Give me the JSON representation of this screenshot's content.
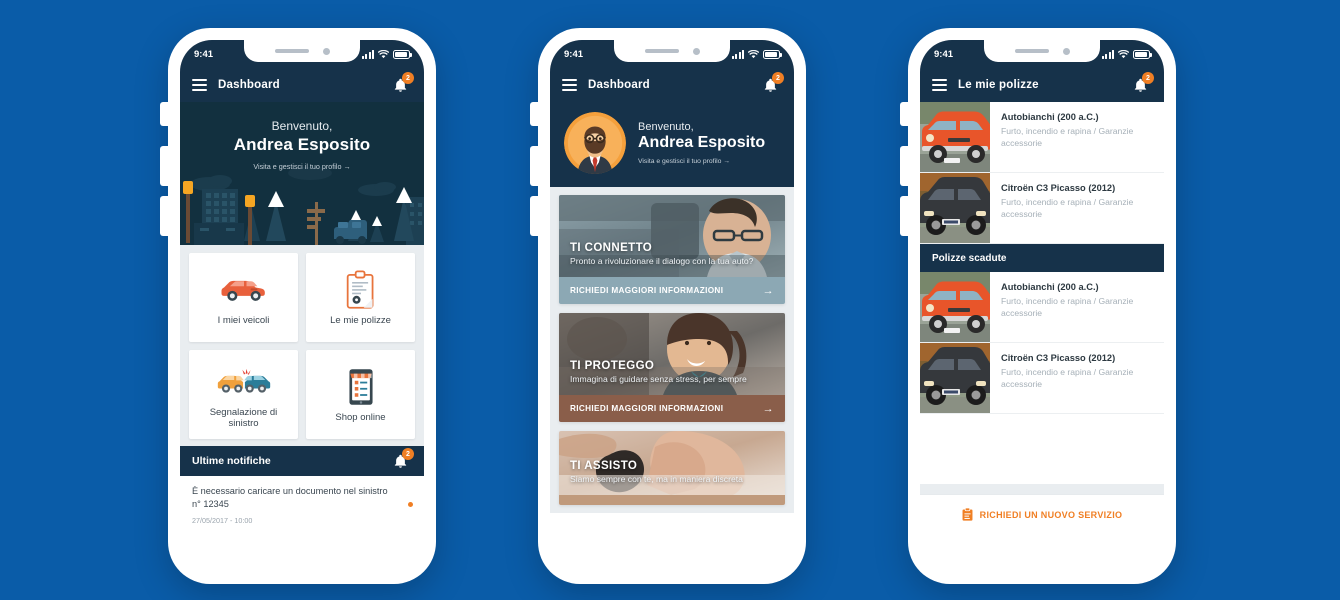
{
  "background_color": "#0a5ca8",
  "brand": {
    "dark": "#16324a",
    "navy": "#12303f",
    "orange": "#f07f24",
    "grey_bg": "#e9edf0"
  },
  "status_bar": {
    "time": "9:41",
    "signal_icon": "signal-bars-icon",
    "wifi_icon": "wifi-icon",
    "battery_icon": "battery-icon"
  },
  "phone1": {
    "appbar": {
      "menu_icon": "hamburger-menu-icon",
      "title": "Dashboard",
      "bell_icon": "bell-icon",
      "badge": "2"
    },
    "hero": {
      "greeting": "Benvenuto,",
      "name": "Andrea Esposito",
      "link": "Visita e gestisci il tuo profilo →",
      "illustration": "city-skyline-illustration"
    },
    "tiles": [
      {
        "label": "I miei veicoli",
        "icon": "car-icon"
      },
      {
        "label": "Le mie polizze",
        "icon": "clipboard-document-icon"
      },
      {
        "label": "Segnalazione di sinistro",
        "icon": "car-crash-icon"
      },
      {
        "label": "Shop online",
        "icon": "online-shop-icon"
      }
    ],
    "notifications": {
      "header": "Ultime notifiche",
      "bell_icon": "bell-icon",
      "badge": "2",
      "items": [
        {
          "text": "È necessario caricare un documento nel sinistro n° 12345",
          "date": "27/05/2017 - 10:00",
          "unread": true
        }
      ]
    }
  },
  "phone2": {
    "appbar": {
      "menu_icon": "hamburger-menu-icon",
      "title": "Dashboard",
      "bell_icon": "bell-icon",
      "badge": "2"
    },
    "hero": {
      "avatar": "bearded-man-avatar",
      "greeting": "Benvenuto,",
      "name": "Andrea Esposito",
      "link": "Visita e gestisci il tuo profilo →"
    },
    "promos": [
      {
        "title": "TI CONNETTO",
        "subtitle": "Pronto a rivoluzionare il dialogo con la tua auto?",
        "cta": "RICHIEDI MAGGIORI INFORMAZIONI",
        "cta_arrow": "→",
        "cta_color": "#8ca8b4",
        "image": "man-driving-car-photo"
      },
      {
        "title": "TI PROTEGGO",
        "subtitle": "Immagina di guidare senza stress, per sempre",
        "cta": "RICHIEDI MAGGIORI INFORMAZIONI",
        "cta_arrow": "→",
        "cta_color": "#8a5e4a",
        "image": "smiling-woman-passenger-photo"
      },
      {
        "title": "TI ASSISTO",
        "subtitle": "Siamo sempre con te, ma in maniera discreta",
        "cta": "",
        "cta_arrow": "",
        "cta_color": "#c09a7c",
        "image": "holding-hands-photo"
      }
    ]
  },
  "phone3": {
    "appbar": {
      "menu_icon": "hamburger-menu-icon",
      "title": "Le mie polizze",
      "bell_icon": "bell-icon",
      "badge": "2"
    },
    "active_policies": [
      {
        "title": "Autobianchi (200 a.C.)",
        "coverage": "Furto, incendio e rapina / Garanzie accessorie",
        "image": "orange-classic-car-photo"
      },
      {
        "title": "Citroën C3 Picasso (2012)",
        "coverage": "Furto, incendio e rapina / Garanzie accessorie",
        "image": "dark-suv-car-photo"
      }
    ],
    "expired_header": "Polizze scadute",
    "expired_policies": [
      {
        "title": "Autobianchi (200 a.C.)",
        "coverage": "Furto, incendio e rapina / Garanzie accessorie",
        "image": "orange-classic-car-photo"
      },
      {
        "title": "Citroën C3 Picasso (2012)",
        "coverage": "Furto, incendio e rapina / Garanzie accessorie",
        "image": "dark-suv-car-photo"
      }
    ],
    "footer": {
      "icon": "clipboard-icon",
      "label": "RICHIEDI UN NUOVO SERVIZIO"
    }
  }
}
